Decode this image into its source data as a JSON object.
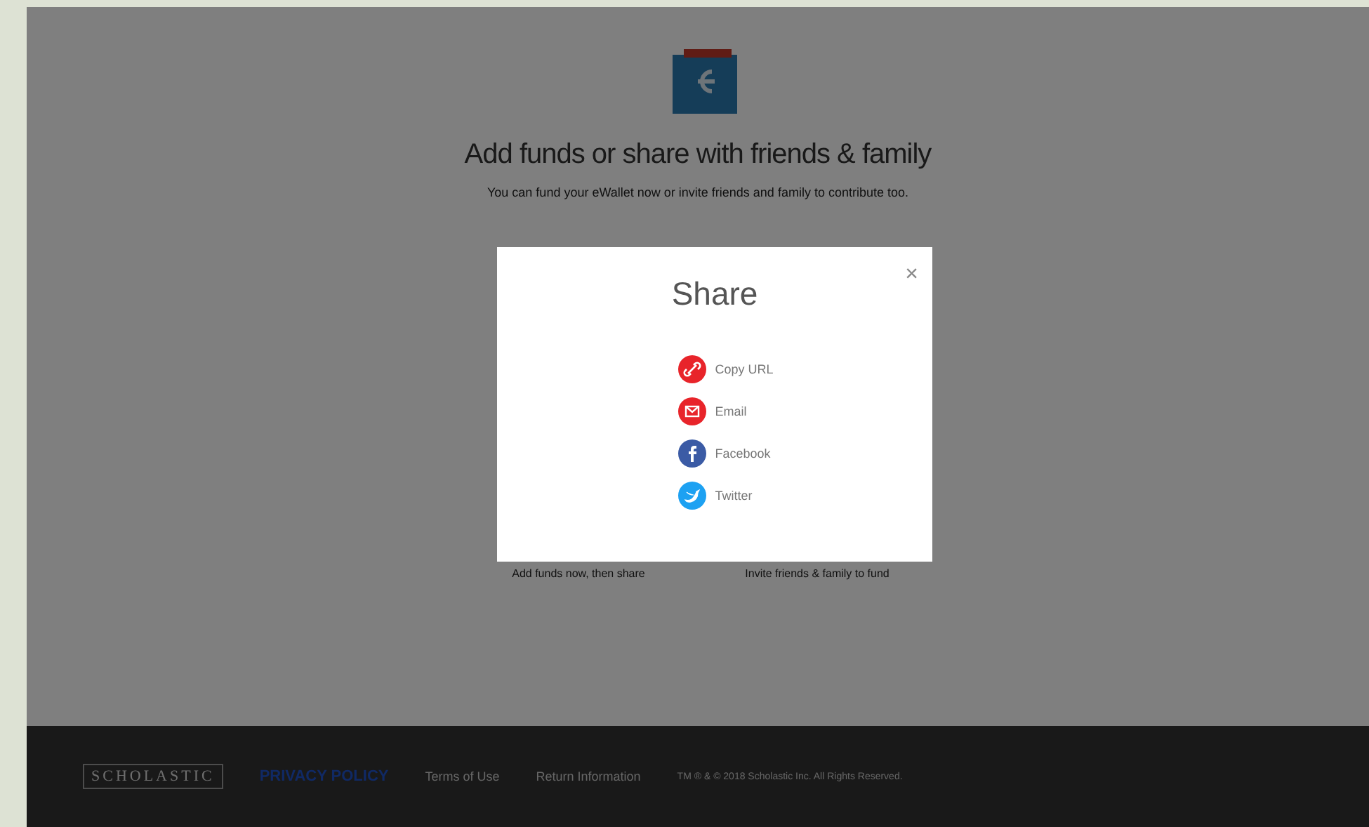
{
  "page": {
    "title": "Add funds or share with friends & family",
    "subtitle": "You can fund your eWallet now or invite friends and family to contribute too.",
    "actions": [
      {
        "label": "Add funds now, then share"
      },
      {
        "label": "Invite friends & family to fund"
      }
    ]
  },
  "footer": {
    "logo": "SCHOLASTIC",
    "links": [
      {
        "label": "PRIVACY POLICY",
        "kind": "highlight"
      },
      {
        "label": "Terms of Use",
        "kind": "plain"
      },
      {
        "label": "Return Information",
        "kind": "plain"
      }
    ],
    "copyright": "TM ® & © 2018 Scholastic Inc. All Rights Reserved."
  },
  "modal": {
    "title": "Share",
    "close": "×",
    "options": [
      {
        "label": "Copy URL",
        "kind": "link",
        "color": "#e8242a"
      },
      {
        "label": "Email",
        "kind": "email",
        "color": "#e8242a"
      },
      {
        "label": "Facebook",
        "kind": "facebook",
        "color": "#3b5ba5"
      },
      {
        "label": "Twitter",
        "kind": "twitter",
        "color": "#1da1f2"
      }
    ]
  }
}
